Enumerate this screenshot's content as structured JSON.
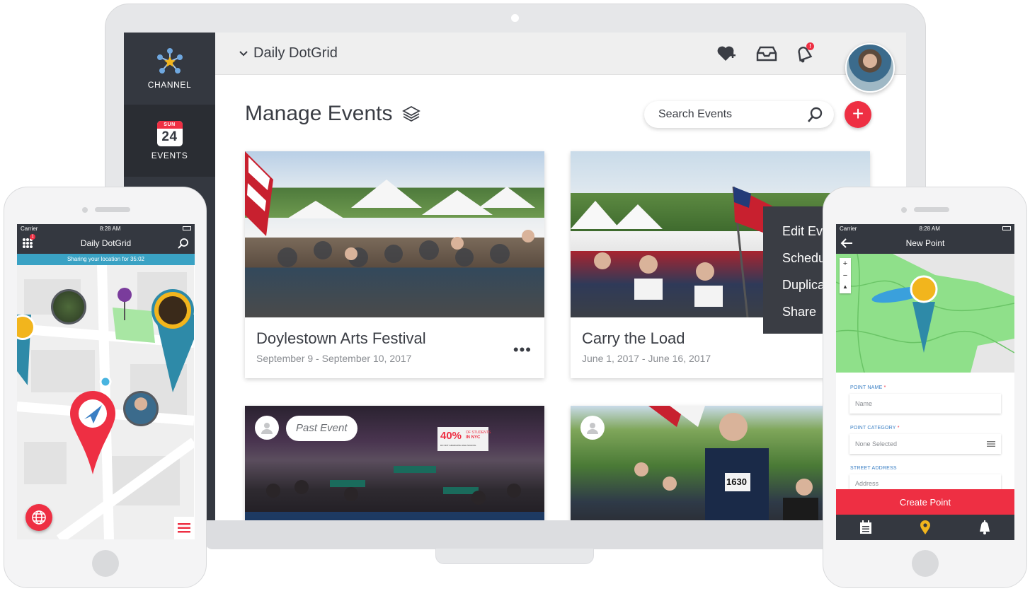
{
  "laptop": {
    "sidebar": {
      "items": [
        {
          "label": "CHANNEL",
          "icon": "channel-molecule-icon"
        },
        {
          "label": "EVENTS",
          "icon": "calendar-icon",
          "calendar_day": "SUN",
          "calendar_date": "24"
        }
      ]
    },
    "topbar": {
      "channel_name": "Daily DotGrid",
      "icons": [
        "heart-add-icon",
        "inbox-icon",
        "bell-icon"
      ],
      "notification_badge": "!"
    },
    "page": {
      "title": "Manage Events",
      "search_placeholder": "Search Events"
    },
    "cards": [
      {
        "title": "Doylestown Arts Festival",
        "dates": "September 9 - September 10, 2017",
        "more": "•••"
      },
      {
        "title": "Carry the Load",
        "dates": "June 1, 2017 - June 16, 2017"
      },
      {
        "badge": "Past Event"
      },
      {}
    ],
    "context_menu": [
      "Edit Ev",
      "Schedu",
      "Duplica",
      "Share"
    ],
    "photo_text": {
      "banner": "40%",
      "banner_line1": "OF STUDENTS",
      "banner_line2": "IN NYC",
      "banner_small": "DO NOT GRADUATE HIGH SCHOOL",
      "bib": "1630"
    }
  },
  "phone_left": {
    "status": {
      "carrier": "Carrier",
      "time": "8:28 AM"
    },
    "title": "Daily DotGrid",
    "notification_badge": "1",
    "share_banner": "Sharing your location for 35:02"
  },
  "phone_right": {
    "status": {
      "carrier": "Carrier",
      "time": "8:28 AM"
    },
    "title": "New Point",
    "zoom_in": "+",
    "zoom_out": "−",
    "form": {
      "point_name_label": "POINT NAME",
      "point_name_placeholder": "Name",
      "point_category_label": "POINT CATEGORY",
      "point_category_value": "None Selected",
      "street_address_label": "STREET ADDRESS",
      "street_address_placeholder": "Address",
      "required_mark": "*"
    },
    "create_button": "Create Point"
  },
  "colors": {
    "dark": "#343840",
    "accent_red": "#ee2f43",
    "share_blue": "#3aa2c4",
    "map_green": "#8fe08a",
    "teal_pin": "#2e8aa8",
    "gold": "#f2b51d"
  }
}
